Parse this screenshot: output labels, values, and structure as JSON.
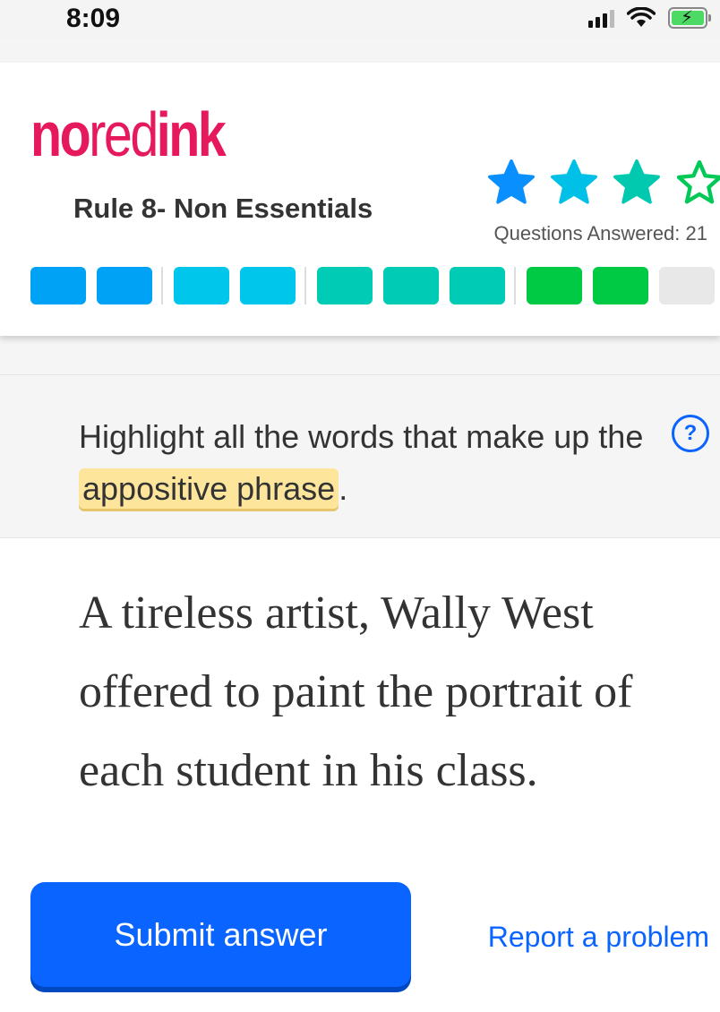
{
  "status_bar": {
    "time": "8:09",
    "icons": [
      "signal-icon",
      "wifi-icon",
      "battery-charging-icon"
    ]
  },
  "header": {
    "logo": {
      "part1": "no",
      "part2": "red",
      "part3": "ink"
    },
    "rule_title": "Rule 8- Non Essentials",
    "stars": {
      "filled": 3,
      "total": 4,
      "colors": [
        "#0a8fff",
        "#00c0e8",
        "#00c9b0",
        "#00c957"
      ]
    },
    "questions_answered": "Questions Answered:  21",
    "progress_segments": [
      "#00a2f5",
      "#00a2f5",
      "divider",
      "#00c6ec",
      "#00c6ec",
      "divider",
      "#00ccb5",
      "#00ccb5",
      "#00ccb5",
      "divider",
      "#00c944",
      "#00c944",
      "#e8e8e8"
    ]
  },
  "instruction": {
    "prefix": "Highlight all the words that make up the",
    "highlight": "appositive phrase",
    "suffix": ".",
    "help_label": "?"
  },
  "sentence": "A tireless artist, Wally West offered to paint the portrait of each student in his class.",
  "footer": {
    "submit_label": "Submit answer",
    "report_label": "Report a problem"
  },
  "colors": {
    "brand": "#e6195d",
    "primary": "#0a64ff",
    "highlight": "#fde59c"
  }
}
